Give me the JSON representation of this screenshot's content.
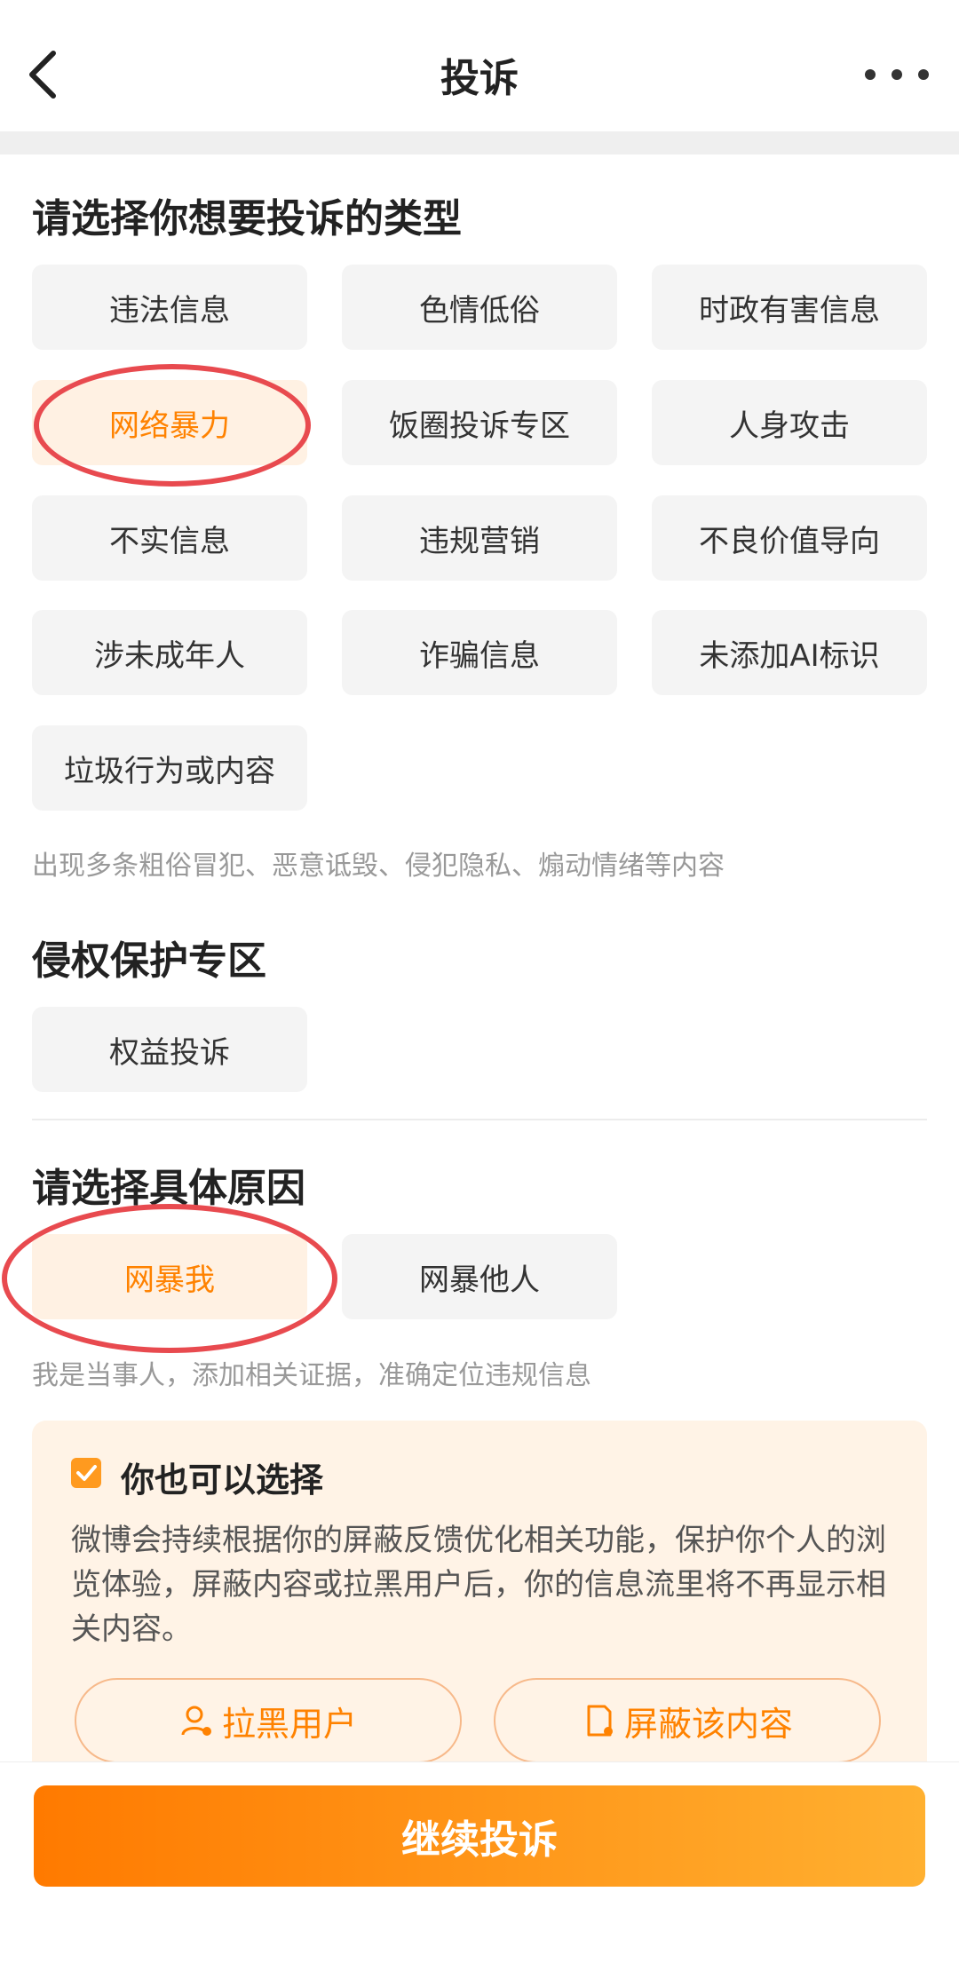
{
  "header": {
    "title": "投诉",
    "back_icon": "chevron-left-icon",
    "more_icon": "more-dots-icon"
  },
  "complaint_type": {
    "title": "请选择你想要投诉的类型",
    "options": [
      {
        "label": "违法信息",
        "selected": false
      },
      {
        "label": "色情低俗",
        "selected": false
      },
      {
        "label": "时政有害信息",
        "selected": false
      },
      {
        "label": "网络暴力",
        "selected": true
      },
      {
        "label": "饭圈投诉专区",
        "selected": false
      },
      {
        "label": "人身攻击",
        "selected": false
      },
      {
        "label": "不实信息",
        "selected": false
      },
      {
        "label": "违规营销",
        "selected": false
      },
      {
        "label": "不良价值导向",
        "selected": false
      },
      {
        "label": "涉未成年人",
        "selected": false
      },
      {
        "label": "诈骗信息",
        "selected": false
      },
      {
        "label": "未添加AI标识",
        "selected": false
      },
      {
        "label": "垃圾行为或内容",
        "selected": false
      }
    ],
    "hint": "出现多条粗俗冒犯、恶意诋毁、侵犯隐私、煽动情绪等内容"
  },
  "rights": {
    "title": "侵权保护专区",
    "options": [
      {
        "label": "权益投诉",
        "selected": false
      }
    ]
  },
  "reason": {
    "title": "请选择具体原因",
    "options": [
      {
        "label": "网暴我",
        "selected": true
      },
      {
        "label": "网暴他人",
        "selected": false
      }
    ],
    "hint": "我是当事人，添加相关证据，准确定位违规信息"
  },
  "alternative": {
    "title": "你也可以选择",
    "description": "微博会持续根据你的屏蔽反馈优化相关功能，保护你个人的浏览体验，屏蔽内容或拉黑用户后，你的信息流里将不再显示相关内容。",
    "block_user_label": "拉黑用户",
    "block_user_icon": "user-block-icon",
    "hide_content_label": "屏蔽该内容",
    "hide_content_icon": "document-hide-icon"
  },
  "footer": {
    "continue_label": "继续投诉"
  },
  "colors": {
    "accent": "#ff8200",
    "selected_bg": "#fff1e3",
    "annotation_ring": "#e84a4f"
  }
}
